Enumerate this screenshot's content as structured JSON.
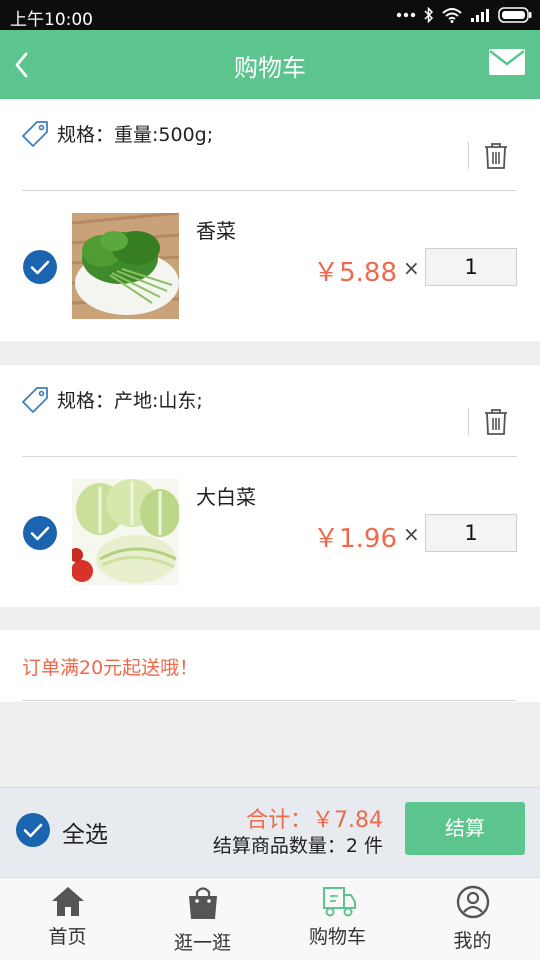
{
  "status_bar": {
    "time": "上午10:00"
  },
  "header": {
    "title": "购物车"
  },
  "cart": {
    "items": [
      {
        "spec": "规格：重量:500g;",
        "name": "香菜",
        "price": "￥5.88",
        "times": "×",
        "quantity": "1",
        "checked": true
      },
      {
        "spec": "规格：产地:山东;",
        "name": "大白菜",
        "price": "￥1.96",
        "times": "×",
        "quantity": "1",
        "checked": true
      }
    ]
  },
  "notice": {
    "text": "订单满20元起送哦！"
  },
  "checkout": {
    "select_all": "全选",
    "total": "合计：￥7.84",
    "count": "结算商品数量：2 件",
    "settle": "结算"
  },
  "nav": {
    "items": [
      {
        "label": "首页",
        "icon": "home-icon"
      },
      {
        "label": "逛一逛",
        "icon": "shopping-bag-icon"
      },
      {
        "label": "购物车",
        "icon": "cart-truck-icon",
        "active": true
      },
      {
        "label": "我的",
        "icon": "user-icon"
      }
    ]
  },
  "colors": {
    "accent": "#5cc58d",
    "price": "#ee6a4c",
    "check": "#1a64b0"
  }
}
